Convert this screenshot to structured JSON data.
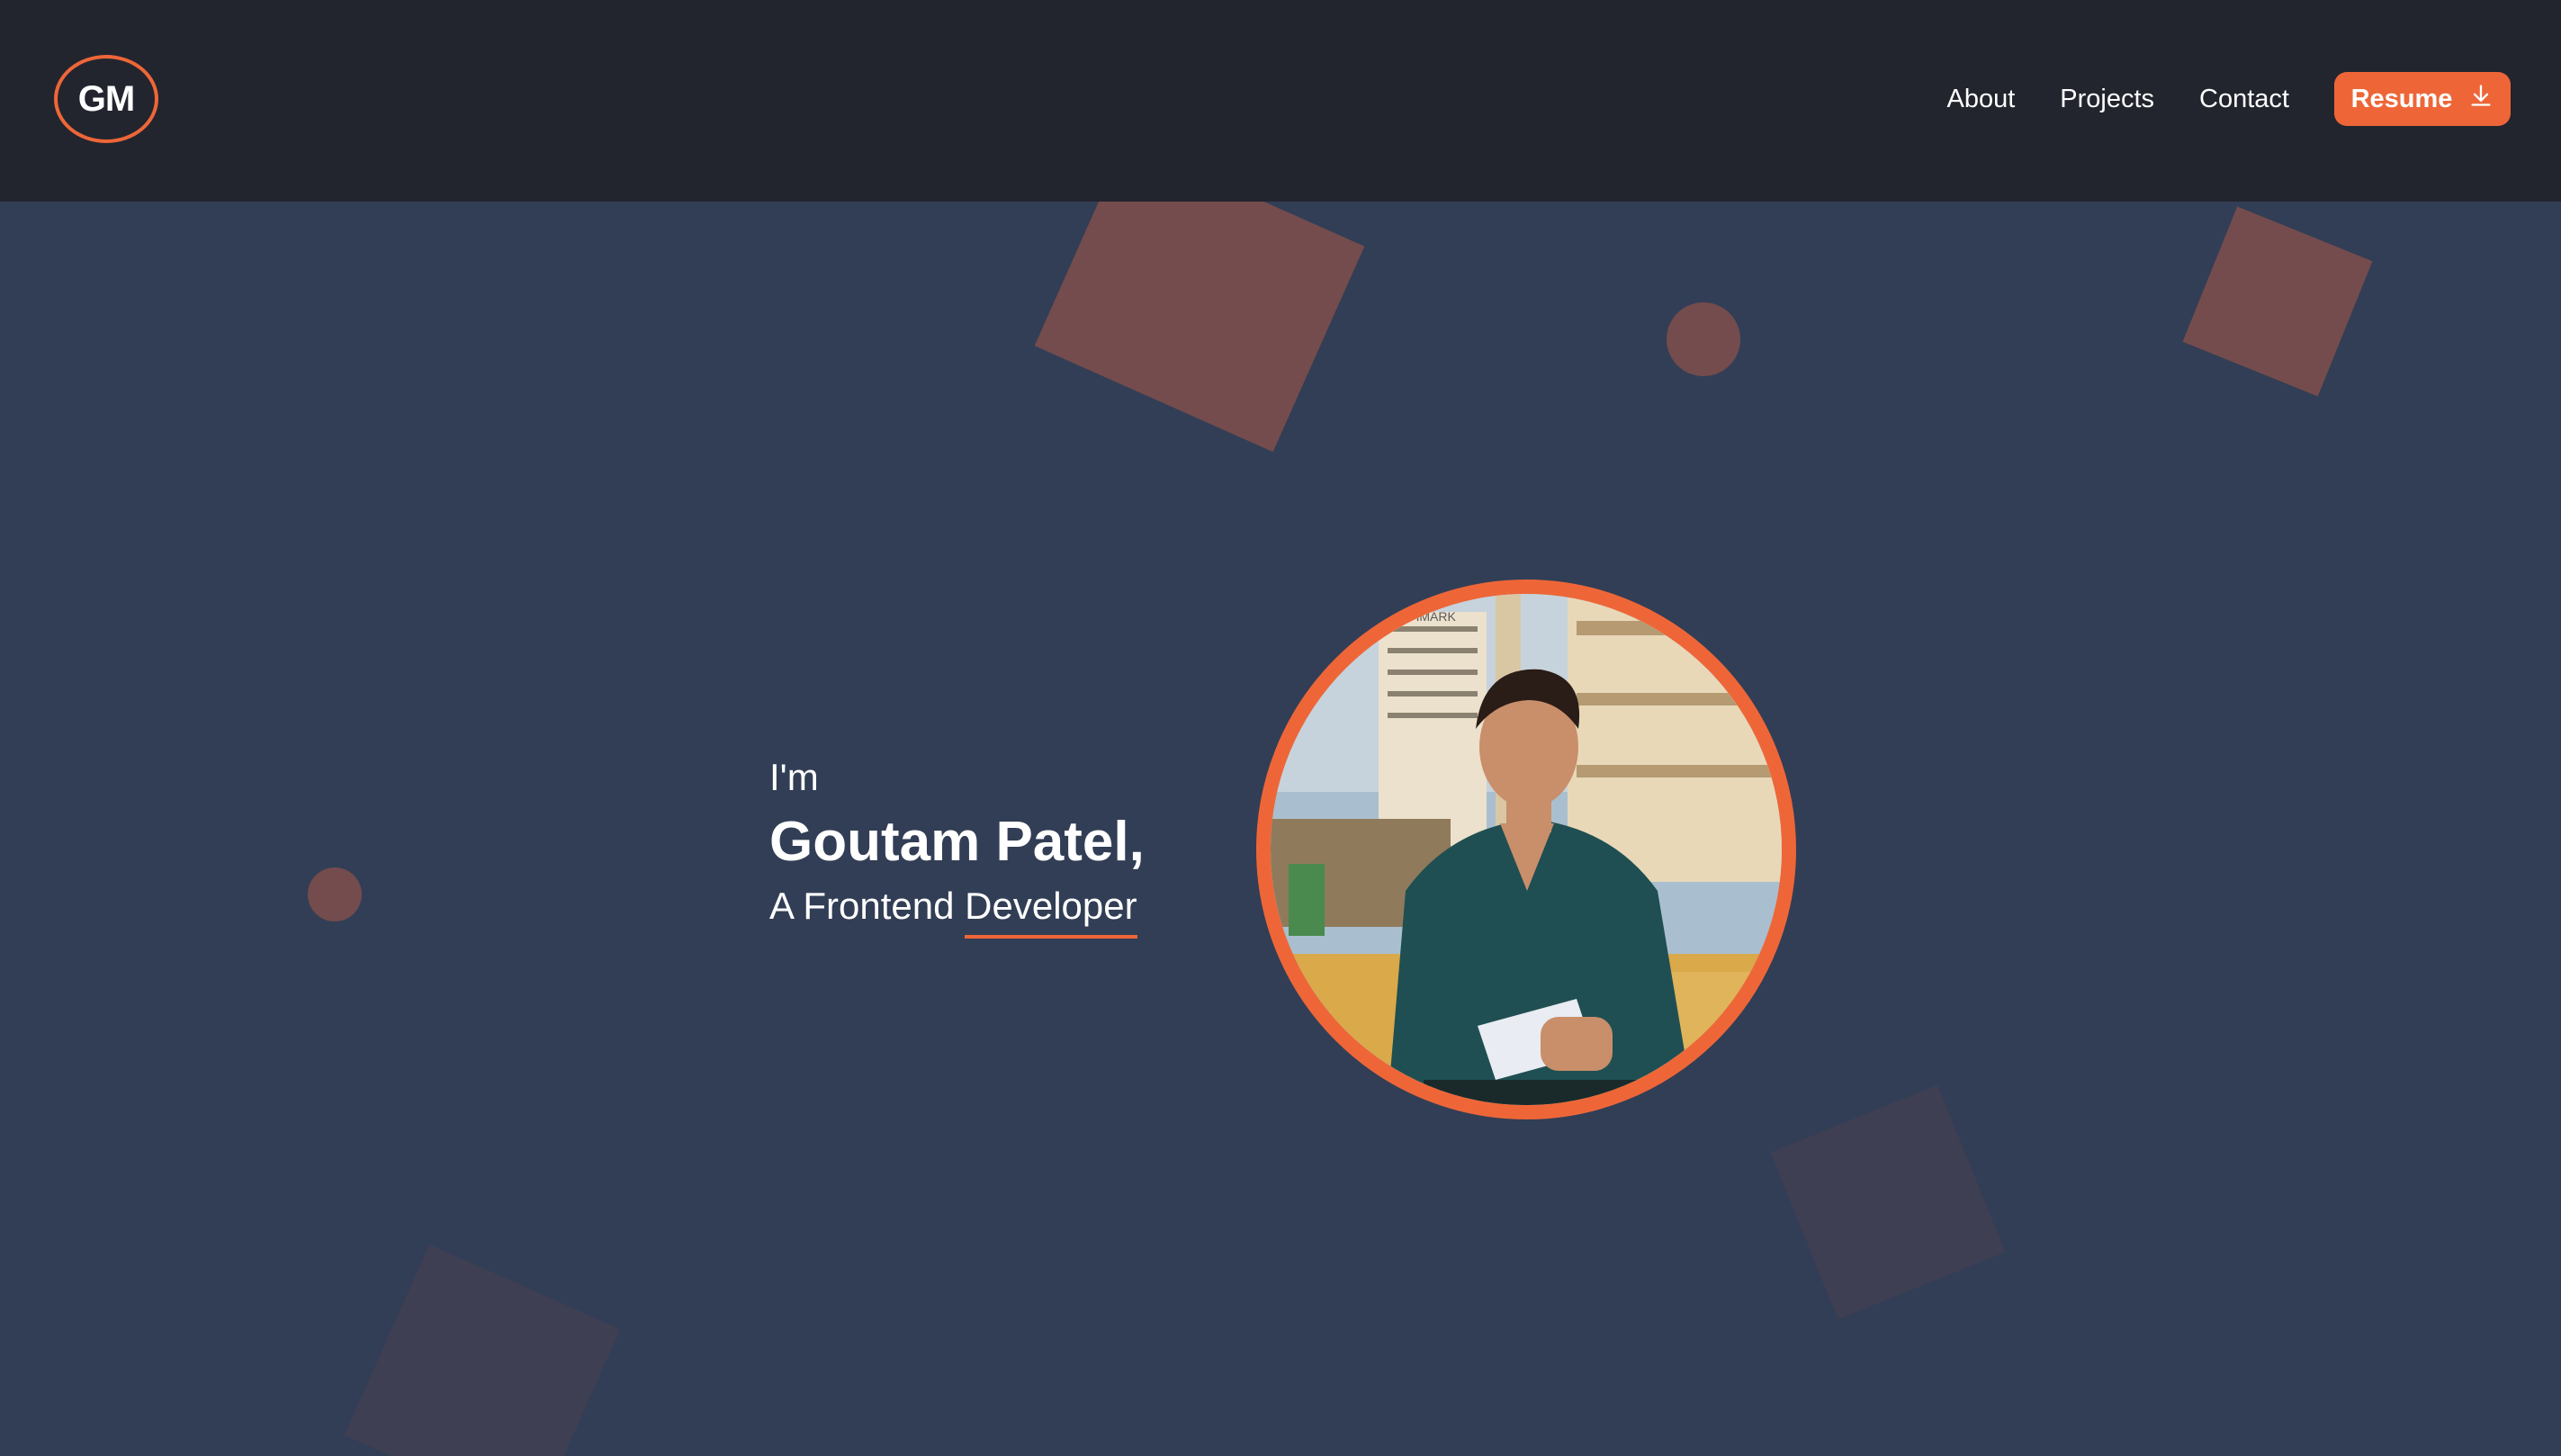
{
  "header": {
    "logo_text": "GM",
    "nav": [
      {
        "label": "About"
      },
      {
        "label": "Projects"
      },
      {
        "label": "Contact"
      }
    ],
    "resume_label": "Resume",
    "resume_icon": "download-icon"
  },
  "hero": {
    "greeting": "I'm",
    "name": "Goutam Patel,",
    "role_prefix": "A Frontend ",
    "role_highlight": "Developer",
    "photo_sign_text": "NCHMARK"
  },
  "colors": {
    "accent": "#ee6638",
    "header_bg": "#22252e",
    "page_bg": "#323e55",
    "shape_warm": "#744c4d",
    "shape_cool": "#3f3f54"
  }
}
